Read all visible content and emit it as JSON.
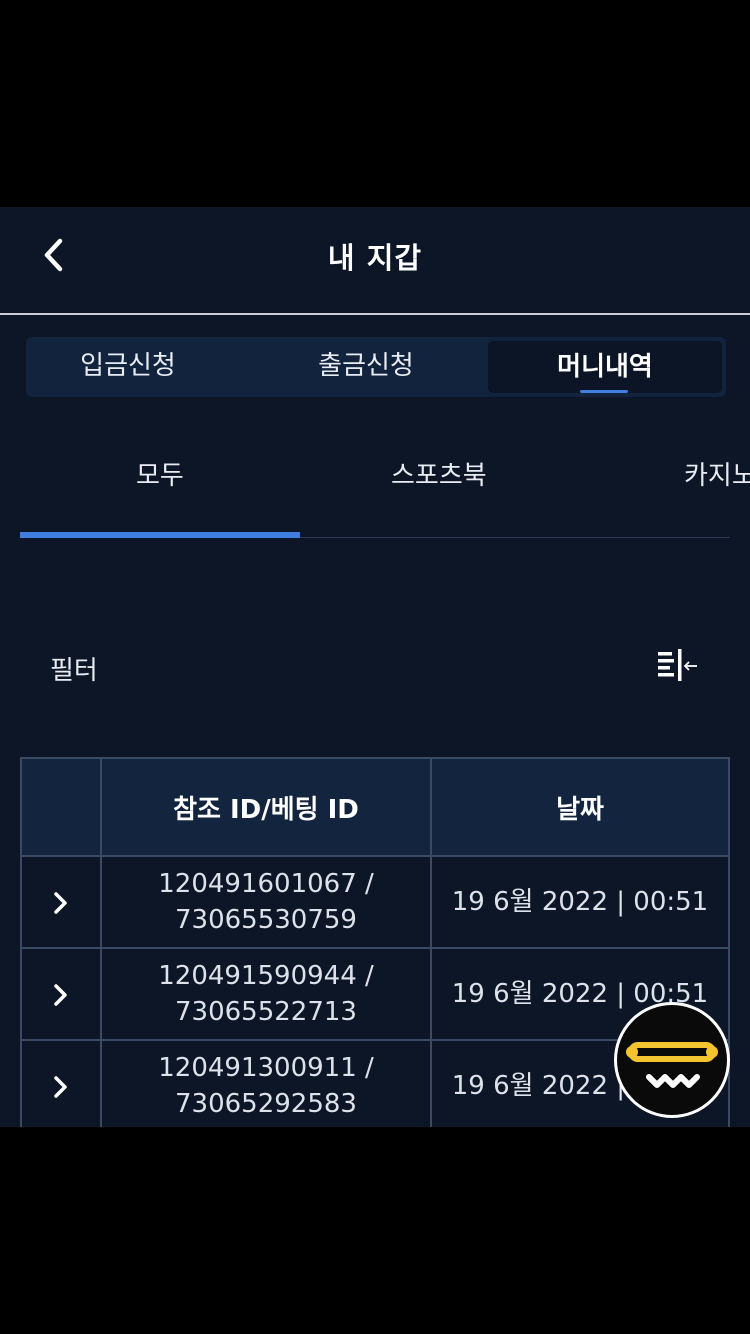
{
  "header": {
    "title": "내 지갑"
  },
  "segments": [
    {
      "label": "입금신청",
      "active": false
    },
    {
      "label": "출금신청",
      "active": false
    },
    {
      "label": "머니내역",
      "active": true
    }
  ],
  "subtabs": [
    {
      "label": "모두",
      "active": true
    },
    {
      "label": "스포츠북",
      "active": false
    },
    {
      "label": "카지노",
      "active": false
    }
  ],
  "filter": {
    "label": "필터",
    "icon": "filter-collapse-icon"
  },
  "table": {
    "headers": [
      "",
      "참조 ID/베팅 ID",
      "날짜"
    ],
    "rows": [
      {
        "ref_id": "120491601067 /",
        "bet_id": "73065530759",
        "date": "19 6월 2022 | 00:51"
      },
      {
        "ref_id": "120491590944 /",
        "bet_id": "73065522713",
        "date": "19 6월 2022 | 00:51"
      },
      {
        "ref_id": "120491300911 /",
        "bet_id": "73065292583",
        "date": "19 6월 2022 | 00:51"
      }
    ]
  },
  "fab": {
    "icon": "chat-support-icon",
    "accent": "#f3c330"
  },
  "colors": {
    "background": "#0c1627",
    "accent": "#3f7de0",
    "table_header": "#13243f",
    "border": "#3a4a62"
  }
}
